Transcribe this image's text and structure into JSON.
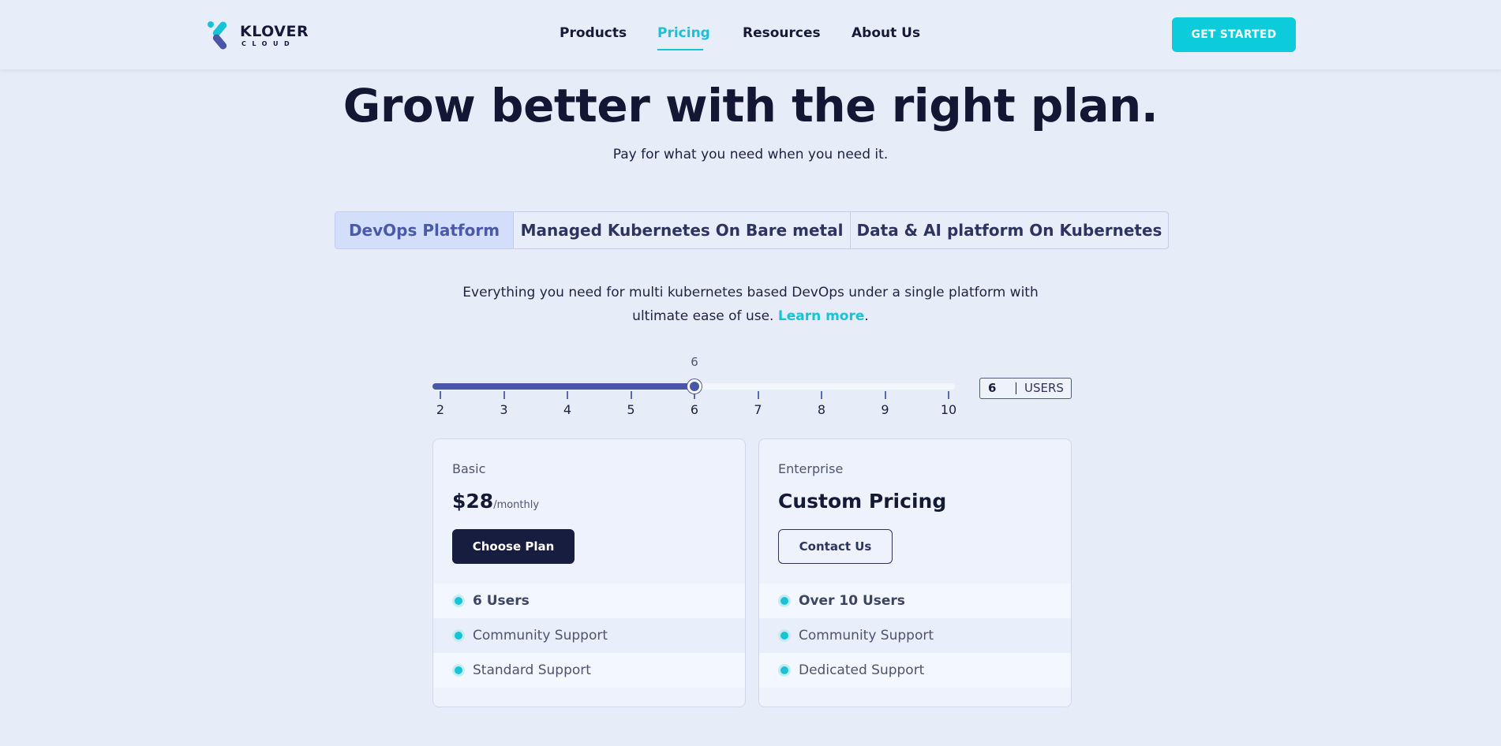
{
  "brand": {
    "name": "KLOVER",
    "sub": "CLOUD",
    "accent": "#17c4d6",
    "dark": "#161d3e"
  },
  "nav": {
    "items": [
      {
        "label": "Products",
        "active": false
      },
      {
        "label": "Pricing",
        "active": true
      },
      {
        "label": "Resources",
        "active": false
      },
      {
        "label": "About Us",
        "active": false
      }
    ],
    "cta": "GET STARTED"
  },
  "hero": {
    "title": "Grow better with the right plan.",
    "subtitle": "Pay for what you need when you need it."
  },
  "tabs": [
    {
      "label": "DevOps Platform",
      "active": true
    },
    {
      "label": "Managed Kubernetes On Bare metal",
      "active": false
    },
    {
      "label": "Data & AI platform On Kubernetes",
      "active": false
    }
  ],
  "description": {
    "line1": "Everything you need for multi kubernetes based DevOps under a single platform with",
    "line2": "ultimate ease of use.",
    "link": "Learn more",
    "after": "."
  },
  "slider": {
    "min": 2,
    "max": 10,
    "value": 6,
    "ticks": [
      "2",
      "3",
      "4",
      "5",
      "6",
      "7",
      "8",
      "9",
      "10"
    ],
    "bubble": "6"
  },
  "users_box": {
    "value": "6",
    "label": "USERS"
  },
  "plans": {
    "basic": {
      "name": "Basic",
      "price": "$28",
      "period": "/monthly",
      "button": "Choose Plan",
      "features": [
        "6 Users",
        "Community Support",
        "Standard Support"
      ]
    },
    "enterprise": {
      "name": "Enterprise",
      "price": "Custom Pricing",
      "button": "Contact Us",
      "features": [
        "Over 10 Users",
        "Community Support",
        "Dedicated Support"
      ]
    }
  }
}
